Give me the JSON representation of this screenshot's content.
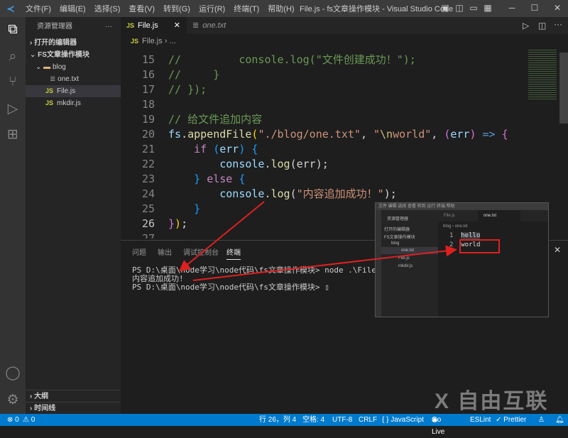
{
  "titlebar": {
    "menus": [
      "文件(F)",
      "编辑(E)",
      "选择(S)",
      "查看(V)",
      "转到(G)",
      "运行(R)",
      "终端(T)",
      "帮助(H)"
    ],
    "title": "File.js - fs文章操作模块 - Visual Studio Code"
  },
  "sidebar": {
    "header": "资源管理器",
    "more": "···",
    "open_editors": "打开的编辑器",
    "folder": "FS文章操作模块",
    "items": [
      {
        "label": "blog",
        "type": "folder"
      },
      {
        "label": "one.txt",
        "type": "txt"
      },
      {
        "label": "File.js",
        "type": "js"
      },
      {
        "label": "mkdir.js",
        "type": "js"
      }
    ],
    "outline": "大纲",
    "timeline": "时间线"
  },
  "tabs": [
    {
      "label": "File.js",
      "icon": "JS",
      "active": true
    },
    {
      "label": "one.txt",
      "active": false
    }
  ],
  "breadcrumb": {
    "file": "File.js",
    "rest": "› ..."
  },
  "code": [
    {
      "n": "15",
      "t": [
        [
          "//         console.log(\"文件创建成功！\");",
          "c"
        ]
      ]
    },
    {
      "n": "16",
      "t": [
        [
          "//     }",
          "c"
        ]
      ]
    },
    {
      "n": "17",
      "t": [
        [
          "// });",
          "c"
        ]
      ]
    },
    {
      "n": "18",
      "t": []
    },
    {
      "n": "19",
      "t": [
        [
          "// 给文件追加内容",
          "c"
        ]
      ]
    },
    {
      "n": "20",
      "t": [
        [
          "fs",
          "v"
        ],
        [
          ".",
          "p"
        ],
        [
          "appendFile",
          "f"
        ],
        [
          "(",
          "b1"
        ],
        [
          "\"./blog/one.txt\"",
          "s"
        ],
        [
          ", ",
          "p"
        ],
        [
          "\"",
          "s"
        ],
        [
          "\\n",
          "e"
        ],
        [
          "world\"",
          "s"
        ],
        [
          ", ",
          "p"
        ],
        [
          "(",
          "b2"
        ],
        [
          "err",
          "v"
        ],
        [
          ")",
          "b2"
        ],
        [
          " => ",
          "kw"
        ],
        [
          "{",
          "b2"
        ]
      ]
    },
    {
      "n": "21",
      "t": [
        [
          "    ",
          "p"
        ],
        [
          "if",
          "k"
        ],
        [
          " ",
          "p"
        ],
        [
          "(",
          "b3"
        ],
        [
          "err",
          "v"
        ],
        [
          ")",
          "b3"
        ],
        [
          " ",
          "p"
        ],
        [
          "{",
          "b3"
        ]
      ]
    },
    {
      "n": "22",
      "t": [
        [
          "        console",
          "v"
        ],
        [
          ".",
          "p"
        ],
        [
          "log",
          "f"
        ],
        [
          "(err);",
          "p"
        ]
      ]
    },
    {
      "n": "23",
      "t": [
        [
          "    ",
          "p"
        ],
        [
          "}",
          "b3"
        ],
        [
          " ",
          "p"
        ],
        [
          "else",
          "k"
        ],
        [
          " ",
          "p"
        ],
        [
          "{",
          "b3"
        ]
      ]
    },
    {
      "n": "24",
      "t": [
        [
          "        console",
          "v"
        ],
        [
          ".",
          "p"
        ],
        [
          "log",
          "f"
        ],
        [
          "(",
          "p"
        ],
        [
          "\"内容追加成功！\"",
          "s"
        ],
        [
          ");",
          "p"
        ]
      ]
    },
    {
      "n": "25",
      "t": [
        [
          "    ",
          "p"
        ],
        [
          "}",
          "b3"
        ]
      ]
    },
    {
      "n": "26",
      "t": [
        [
          "}",
          "b2"
        ],
        [
          ")",
          "b1"
        ],
        [
          ";",
          "p"
        ]
      ]
    },
    {
      "n": "27",
      "t": []
    }
  ],
  "panel": {
    "tabs": [
      "问题",
      "输出",
      "调试控制台",
      "终端"
    ],
    "active": "终端",
    "lines": [
      "PS D:\\桌面\\node学习\\node代码\\fs文章操作模块> node .\\File.js",
      "内容追加成功!",
      "PS D:\\桌面\\node学习\\node代码\\fs文章操作模块> ▯"
    ]
  },
  "inset": {
    "tabs": [
      "File.js",
      "one.txt"
    ],
    "breadcrumb": "blog › one.txt",
    "lines": [
      {
        "n": "1",
        "text": "hello"
      },
      {
        "n": "2",
        "text": "world"
      }
    ],
    "tree": [
      "打开的编辑器",
      "FS文章操作模块",
      "blog",
      "one.txt",
      "File.js",
      "mkdir.js"
    ],
    "header": "资源管理器"
  },
  "status": {
    "errors": "⊗ 0",
    "warnings": "⚠ 0",
    "position": "行 26，列 4",
    "spaces": "空格: 4",
    "encoding": "UTF-8",
    "eol": "CRLF",
    "language": "{ } JavaScript",
    "golive": "Go Live",
    "eslint": "ESLint",
    "prettier": "✓ Prettier"
  },
  "watermark": "X 自由互联",
  "colors": {
    "statusbar": "#007acc",
    "annotation": "#e02020"
  }
}
